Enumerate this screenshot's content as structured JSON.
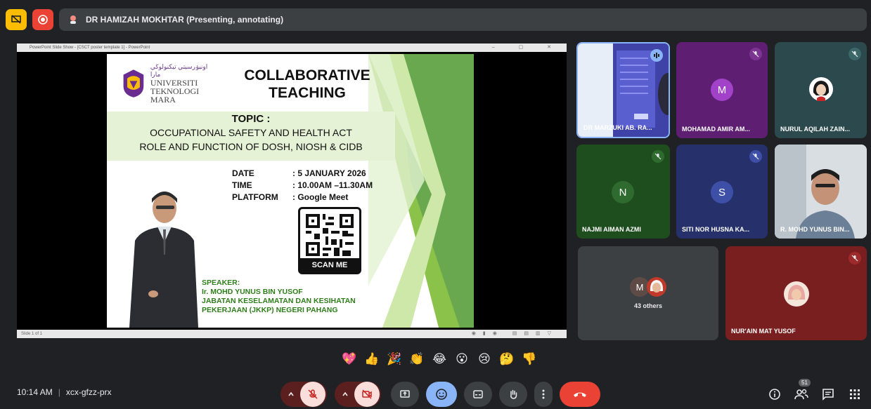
{
  "presenter": {
    "label": "DR HAMIZAH MOKHTAR (Presenting, annotating)"
  },
  "ppt": {
    "window_title": "PowerPoint Slide Show - [CSCT poster template 1] - PowerPoint",
    "status": "Slide 1 of 1"
  },
  "slide": {
    "logo_arabic": "اونيۏرسيتي تيكنولوڬي مارا",
    "logo_lines": [
      "UNIVERSITI",
      "TEKNOLOGI",
      "MARA"
    ],
    "title_line1": "COLLABORATIVE",
    "title_line2": "TEACHING",
    "topic_label": "TOPIC :",
    "topic_line1": "OCCUPATIONAL SAFETY AND HEALTH ACT",
    "topic_line2": "ROLE AND FUNCTION OF DOSH, NIOSH & CIDB",
    "date_key": "DATE",
    "date_val": ": 5 JANUARY 2026",
    "time_key": "TIME",
    "time_val": ": 10.00AM –11.30AM",
    "platform_key": "PLATFORM",
    "platform_val": ": Google Meet",
    "scan": "SCAN ME",
    "speaker_label": "SPEAKER:",
    "speaker_name": "Ir. MOHD YUNUS BIN YUSOF",
    "speaker_org1": "JABATAN KESELAMATAN DAN KESIHATAN",
    "speaker_org2": "PEKERJAAN (JKKP) NEGERI PAHANG"
  },
  "participants": [
    {
      "name": "DR MARZUKI AB. RA...",
      "color": "#3d3f8f"
    },
    {
      "name": "MOHAMAD AMIR AM...",
      "initial": "M",
      "color": "#5e1f73",
      "avatar_color": "#a142c9"
    },
    {
      "name": "NURUL AQILAH ZAIN...",
      "color": "#2c4a4d"
    },
    {
      "name": "NAJMI AIMAN AZMI",
      "initial": "N",
      "color": "#1e4d1e",
      "avatar_color": "#2f6b2f"
    },
    {
      "name": "SITI NOR HUSNA KA...",
      "initial": "S",
      "color": "#26306b",
      "avatar_color": "#3e4fa8"
    },
    {
      "name": "R. MOHD YUNUS BIN...",
      "color": "#6e7a86"
    },
    {
      "name": "43 others",
      "initial": "M",
      "color": "#3c4043"
    },
    {
      "name": "NUR'AIN MAT YUSOF",
      "color": "#7a1f1f"
    }
  ],
  "others": {
    "label": "43 others",
    "initial": "M"
  },
  "reactions": [
    "💖",
    "👍",
    "🎉",
    "👏",
    "😂",
    "😮",
    "😢",
    "🤔",
    "👎"
  ],
  "meeting": {
    "time": "10:14 AM",
    "code": "xcx-gfzz-prx"
  },
  "people_count": "51",
  "colors": {
    "bg": "#202124",
    "red": "#ea4335",
    "yellow": "#fbbc04",
    "blue": "#8ab4f8",
    "control_dark": "#3c4043"
  },
  "icons": [
    "screen-share-off-icon",
    "record-icon",
    "annotate-icon",
    "microphone-off-icon",
    "camera-off-icon",
    "present-icon",
    "emoji-icon",
    "captions-icon",
    "hand-raise-icon",
    "more-options-icon",
    "end-call-icon",
    "info-icon",
    "people-icon",
    "chat-icon",
    "activities-icon"
  ]
}
